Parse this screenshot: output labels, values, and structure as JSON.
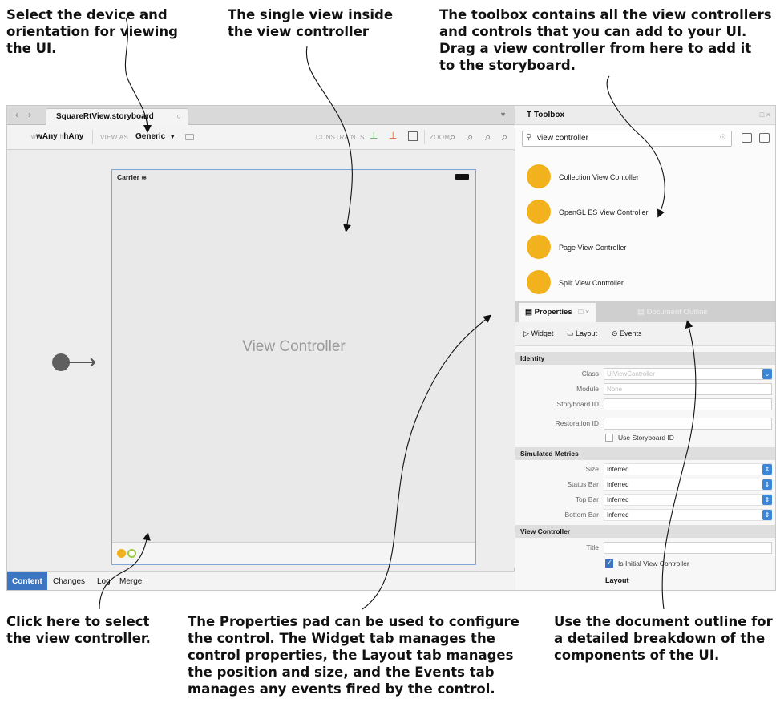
{
  "callouts": {
    "device": [
      "Select the device and",
      "orientation for viewing",
      "the UI."
    ],
    "single_view": [
      "The single view inside",
      "the view controller"
    ],
    "toolbox": [
      "The toolbox contains all the view controllers",
      "and controls that you can add to your UI.",
      "Drag a view controller from here to add it",
      "to the storyboard."
    ],
    "select_vc": [
      "Click here to select",
      "the view controller."
    ],
    "properties": [
      "The Properties pad can be used to configure",
      "the control. The Widget tab manages the",
      "control properties, the Layout tab manages",
      "the position and size, and the Events tab",
      "manages any events fired by the control."
    ],
    "outline": [
      "Use the document outline for",
      "a detailed breakdown of the",
      "components of the UI."
    ]
  },
  "editor": {
    "tab_title": "SquareRtView.storyboard",
    "toolbar": {
      "size_w": "wAny",
      "size_h": "hAny",
      "view_as_label": "VIEW AS",
      "view_as_value": "Generic",
      "constraints_label": "CONSTRAINTS",
      "zoom_label": "ZOOM"
    },
    "device": {
      "carrier": "Carrier",
      "title": "View Controller"
    },
    "bottom_tabs": [
      "Content",
      "Changes",
      "Log",
      "Merge"
    ]
  },
  "toolbox": {
    "title": "Toolbox",
    "search_value": "view controller",
    "items": [
      "Collection View Contoller",
      "OpenGL ES View Controller",
      "Page View Controller",
      "Split View Controller"
    ]
  },
  "properties": {
    "tabs": [
      "Properties",
      "Document Outline"
    ],
    "subtabs": [
      "Widget",
      "Layout",
      "Events"
    ],
    "sections": {
      "identity": "Identity",
      "simulated": "Simulated Metrics",
      "view_controller": "View Controller"
    },
    "identity": {
      "class_label": "Class",
      "class_placeholder": "UIViewController",
      "module_label": "Module",
      "module_placeholder": "None",
      "storyboard_id_label": "Storyboard ID",
      "restoration_id_label": "Restoration ID",
      "use_storyboard_id": "Use Storyboard ID"
    },
    "simulated": [
      {
        "label": "Size",
        "value": "Inferred"
      },
      {
        "label": "Status Bar",
        "value": "Inferred"
      },
      {
        "label": "Top Bar",
        "value": "Inferred"
      },
      {
        "label": "Bottom Bar",
        "value": "Inferred"
      }
    ],
    "view_controller": {
      "title_label": "Title",
      "is_initial": "Is Initial View Controller",
      "layout_label": "Layout"
    }
  }
}
